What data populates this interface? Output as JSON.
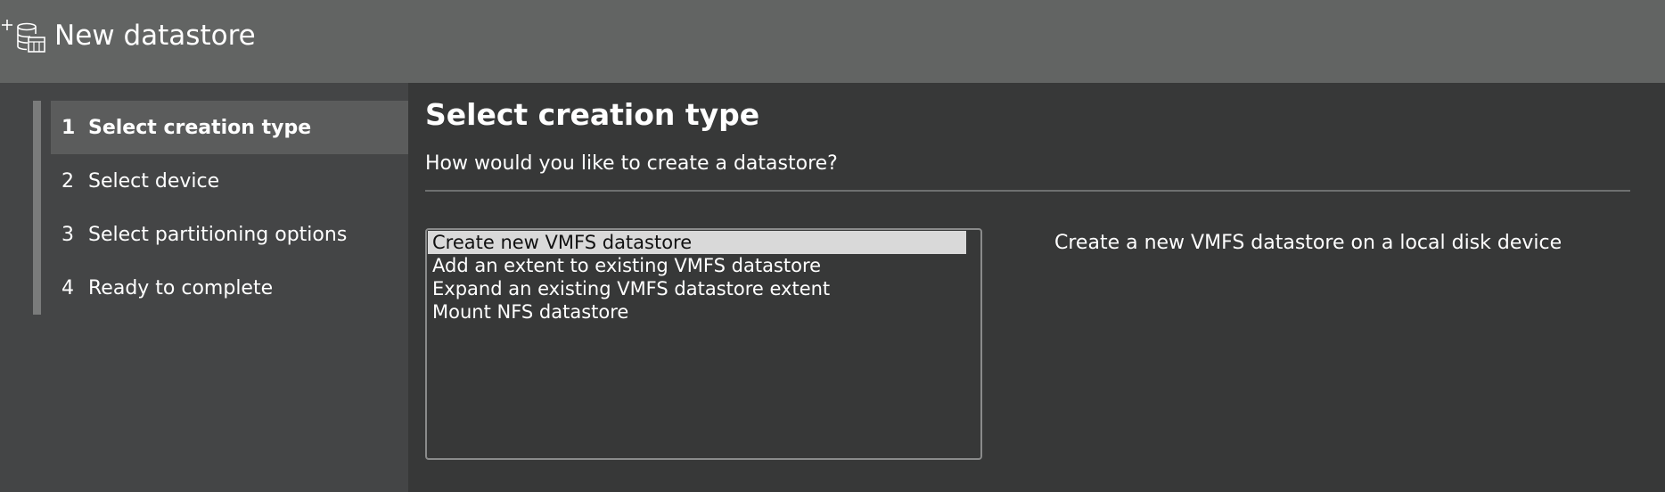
{
  "window": {
    "title": "New datastore",
    "icon": "new-datastore-icon"
  },
  "steps": [
    {
      "number": "1",
      "label": "Select creation type",
      "active": true
    },
    {
      "number": "2",
      "label": "Select device",
      "active": false
    },
    {
      "number": "3",
      "label": "Select partitioning options",
      "active": false
    },
    {
      "number": "4",
      "label": "Ready to complete",
      "active": false
    }
  ],
  "main": {
    "title": "Select creation type",
    "subtitle": "How would you like to create a datastore?",
    "options": [
      {
        "label": "Create new VMFS datastore",
        "selected": true
      },
      {
        "label": "Add an extent to existing VMFS datastore",
        "selected": false
      },
      {
        "label": "Expand an existing VMFS datastore extent",
        "selected": false
      },
      {
        "label": "Mount NFS datastore",
        "selected": false
      }
    ],
    "description": "Create a new VMFS datastore on a local disk device"
  },
  "colors": {
    "titlebar": "#626463",
    "sidebar": "#444546",
    "main": "#373838",
    "active_step": "#5b5c5c",
    "selected_option": "#d9d9d9"
  }
}
